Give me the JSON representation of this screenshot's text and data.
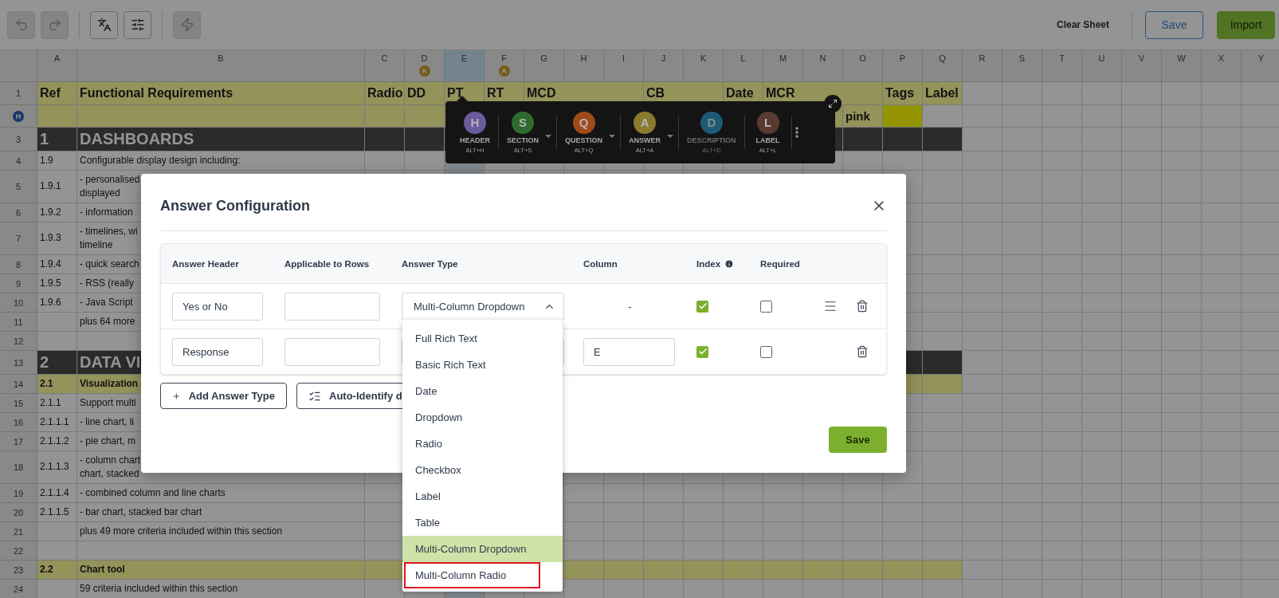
{
  "toolbar": {
    "buttons": [
      {
        "disabled": true
      },
      {
        "disabled": true
      },
      {
        "disabled": false
      },
      {
        "disabled": false
      },
      {
        "disabled": true
      }
    ],
    "clear_label": "Clear Sheet",
    "save_label": "Save",
    "import_label": "Import"
  },
  "sheet": {
    "columns": [
      {
        "letter": "A",
        "selected": false
      },
      {
        "letter": "B",
        "selected": false
      },
      {
        "letter": "C",
        "selected": false
      },
      {
        "letter": "D",
        "selected": false,
        "badge": "A"
      },
      {
        "letter": "E",
        "selected": true
      },
      {
        "letter": "F",
        "selected": false,
        "badge": "A"
      },
      {
        "letter": "G",
        "selected": false
      },
      {
        "letter": "H",
        "selected": false
      },
      {
        "letter": "I",
        "selected": false
      },
      {
        "letter": "J",
        "selected": false
      },
      {
        "letter": "K",
        "selected": false
      },
      {
        "letter": "L",
        "selected": false
      },
      {
        "letter": "M",
        "selected": false
      },
      {
        "letter": "N",
        "selected": false
      },
      {
        "letter": "O",
        "selected": false
      },
      {
        "letter": "P",
        "selected": false
      },
      {
        "letter": "Q",
        "selected": false
      },
      {
        "letter": "R",
        "selected": false
      },
      {
        "letter": "S",
        "selected": false
      },
      {
        "letter": "T",
        "selected": false
      },
      {
        "letter": "U",
        "selected": false
      },
      {
        "letter": "V",
        "selected": false
      },
      {
        "letter": "W",
        "selected": false
      },
      {
        "letter": "X",
        "selected": false
      },
      {
        "letter": "Y",
        "selected": false
      }
    ],
    "header_row": {
      "number": "1",
      "cells": [
        "Ref",
        "Functional Requirements",
        "Radio",
        "DD",
        "PT",
        "RT",
        "MCD",
        "CB",
        "Date",
        "MCR",
        "Tags",
        "Label"
      ]
    },
    "rows": [
      {
        "kind": "marker",
        "badge": "H",
        "note": "pink",
        "highlight": true
      },
      {
        "kind": "section",
        "number": "3",
        "ref": "1",
        "text": "DASHBOARDS"
      },
      {
        "kind": "item",
        "number": "4",
        "ref": "1.9",
        "text": "Configurable display design including:"
      },
      {
        "kind": "item",
        "number": "5",
        "ref": "1.9.1",
        "text": "- personalised\ndisplayed"
      },
      {
        "kind": "item",
        "number": "6",
        "ref": "1.9.2",
        "text": "- information"
      },
      {
        "kind": "item",
        "number": "7",
        "ref": "1.9.3",
        "text": "- timelines, wi\ntimeline"
      },
      {
        "kind": "item",
        "number": "8",
        "ref": "1.9.4",
        "text": "- quick search"
      },
      {
        "kind": "item",
        "number": "9",
        "ref": "1.9.5",
        "text": "- RSS (really"
      },
      {
        "kind": "item",
        "number": "10",
        "ref": "1.9.6",
        "text": "- Java Script"
      },
      {
        "kind": "item",
        "number": "11",
        "text": "plus 64 more"
      },
      {
        "kind": "item",
        "number": "12"
      },
      {
        "kind": "section",
        "number": "13",
        "ref": "2",
        "text": "DATA VI"
      },
      {
        "kind": "group",
        "number": "14",
        "ref": "2.1",
        "text": "Visualization"
      },
      {
        "kind": "item",
        "number": "15",
        "ref": "2.1.1",
        "text": "Support multi"
      },
      {
        "kind": "item",
        "number": "16",
        "ref": "2.1.1.1",
        "text": "- line chart, li"
      },
      {
        "kind": "item",
        "number": "17",
        "ref": "2.1.1.2",
        "text": "- pie chart, m"
      },
      {
        "kind": "item",
        "number": "18",
        "ref": "2.1.1.3",
        "text": "- column chart\nchart, stacked"
      },
      {
        "kind": "item",
        "number": "19",
        "ref": "2.1.1.4",
        "text": "- combined column and line charts"
      },
      {
        "kind": "item",
        "number": "20",
        "ref": "2.1.1.5",
        "text": "- bar chart, stacked bar chart"
      },
      {
        "kind": "item",
        "number": "21",
        "text": "plus 49 more criteria included within this section"
      },
      {
        "kind": "item",
        "number": "22"
      },
      {
        "kind": "group",
        "number": "23",
        "ref": "2.2",
        "text": "Chart tool"
      },
      {
        "kind": "item",
        "number": "24",
        "text": "59 criteria included within this section"
      }
    ]
  },
  "format_bar": {
    "items": [
      {
        "letter": "H",
        "label": "HEADER",
        "shortcut": "ALT+H",
        "color": "#6a5a9e",
        "disabled": false,
        "menu": false
      },
      {
        "letter": "S",
        "label": "SECTION",
        "shortcut": "ALT+S",
        "color": "#2e6a2e",
        "disabled": false,
        "menu": true
      },
      {
        "letter": "Q",
        "label": "QUESTION",
        "shortcut": "ALT+Q",
        "color": "#a04a1a",
        "disabled": false,
        "menu": true
      },
      {
        "letter": "A",
        "label": "ANSWER",
        "shortcut": "ALT+A",
        "color": "#8a7a30",
        "disabled": false,
        "menu": true
      },
      {
        "letter": "D",
        "label": "DESCRIPTION",
        "shortcut": "ALT+D",
        "color": "#1e5a78",
        "disabled": true,
        "menu": false
      },
      {
        "letter": "L",
        "label": "LABEL",
        "shortcut": "ALT+L",
        "color": "#5a3a30",
        "disabled": false,
        "menu": false
      }
    ]
  },
  "dialog": {
    "title": "Answer Configuration",
    "columns": [
      "Answer Header",
      "Applicable to Rows",
      "Answer Type",
      "Column",
      "Index",
      "Required"
    ],
    "rows": [
      {
        "header": "Yes or No",
        "answer_type": "Multi-Column Dropdown",
        "open": true,
        "column": {
          "kind": "text",
          "value": "-"
        },
        "index": true,
        "required": false,
        "reorder": true
      },
      {
        "header": "Response",
        "column": {
          "kind": "input",
          "value": "E"
        },
        "index": true,
        "required": false,
        "reorder": false
      }
    ],
    "add_label": "Add Answer Type",
    "auto_label": "Auto-Identify d",
    "save_label": "Save"
  },
  "answer_type_menu": {
    "options": [
      {
        "label": "Full Rich Text",
        "selected": false,
        "outlined": false
      },
      {
        "label": "Basic Rich Text",
        "selected": false,
        "outlined": false
      },
      {
        "label": "Date",
        "selected": false,
        "outlined": false
      },
      {
        "label": "Dropdown",
        "selected": false,
        "outlined": false
      },
      {
        "label": "Radio",
        "selected": false,
        "outlined": false
      },
      {
        "label": "Checkbox",
        "selected": false,
        "outlined": false
      },
      {
        "label": "Label",
        "selected": false,
        "outlined": false
      },
      {
        "label": "Table",
        "selected": false,
        "outlined": false
      },
      {
        "label": "Multi-Column Dropdown",
        "selected": true,
        "outlined": false
      },
      {
        "label": "Multi-Column Radio",
        "selected": false,
        "outlined": true
      }
    ]
  }
}
